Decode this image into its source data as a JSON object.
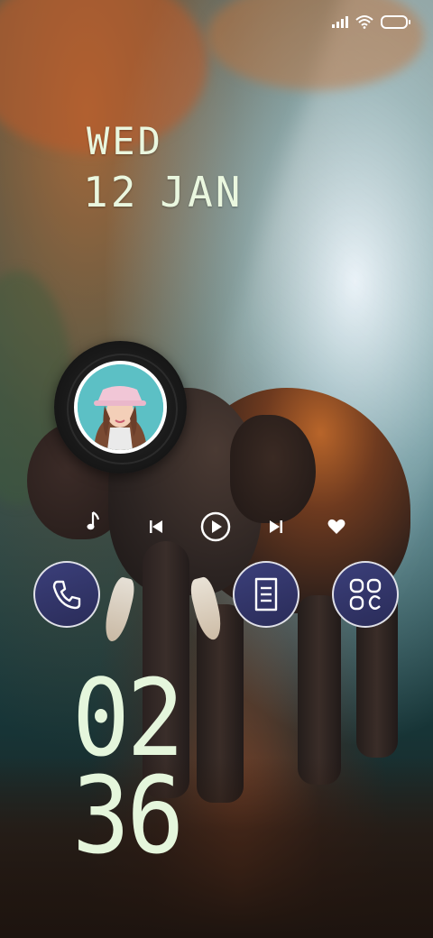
{
  "status_bar": {
    "signal": "signal-icon",
    "wifi": "wifi-icon",
    "battery": "battery-icon"
  },
  "date": {
    "day_of_week": "WED",
    "day": "12",
    "month": "JAN"
  },
  "music": {
    "album_art": "album-art",
    "controls": [
      "music-note-icon",
      "previous-icon",
      "play-icon",
      "next-icon",
      "heart-icon"
    ]
  },
  "apps": [
    "phone-icon",
    "notes-icon",
    "apps-grid-icon"
  ],
  "time": {
    "hours": "02",
    "minutes": "36"
  },
  "colors": {
    "clock_text": "#e5f6dc",
    "app_circle": "#2f3266"
  }
}
